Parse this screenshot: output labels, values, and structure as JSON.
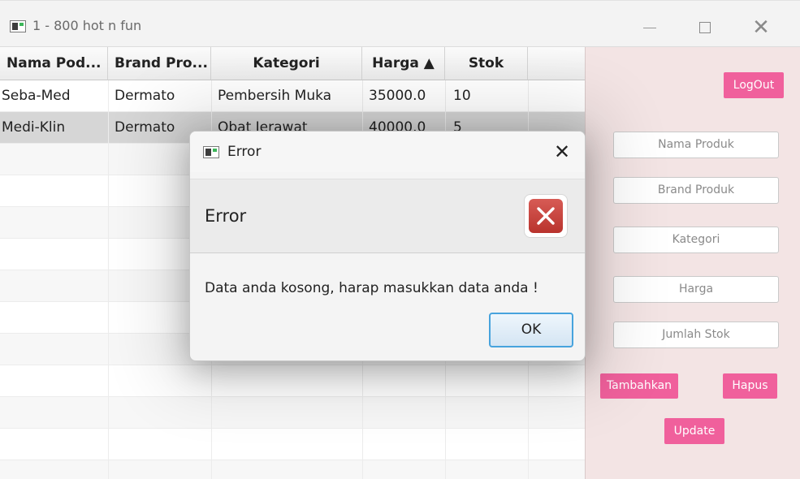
{
  "window": {
    "title": "1 - 800 hot n fun"
  },
  "table": {
    "columns": [
      "Nama Pod...",
      "Brand Pro...",
      "Kategori",
      "Harga ▲",
      "Stok"
    ],
    "rows": [
      [
        "Seba-Med",
        "Dermato",
        "Pembersih Muka",
        "35000.0",
        "10"
      ],
      [
        "Medi-Klin",
        "Dermato",
        "Obat Jerawat",
        "40000.0",
        "5"
      ]
    ]
  },
  "side": {
    "logout": "LogOut",
    "nama_produk": "Nama Produk",
    "brand_produk": "Brand Produk",
    "kategori": "Kategori",
    "harga": "Harga",
    "jumlah_stok": "Jumlah Stok",
    "tambahkan": "Tambahkan",
    "hapus": "Hapus",
    "update": "Update"
  },
  "dialog": {
    "title": "Error",
    "header": "Error",
    "content": "Data anda kosong, harap masukkan data anda !",
    "ok": "OK"
  },
  "colors": {
    "accent_pink": "#f0609c",
    "panel_bg": "#f3e4e4",
    "error_red": "#c9423c",
    "ok_border": "#47a3dd"
  }
}
